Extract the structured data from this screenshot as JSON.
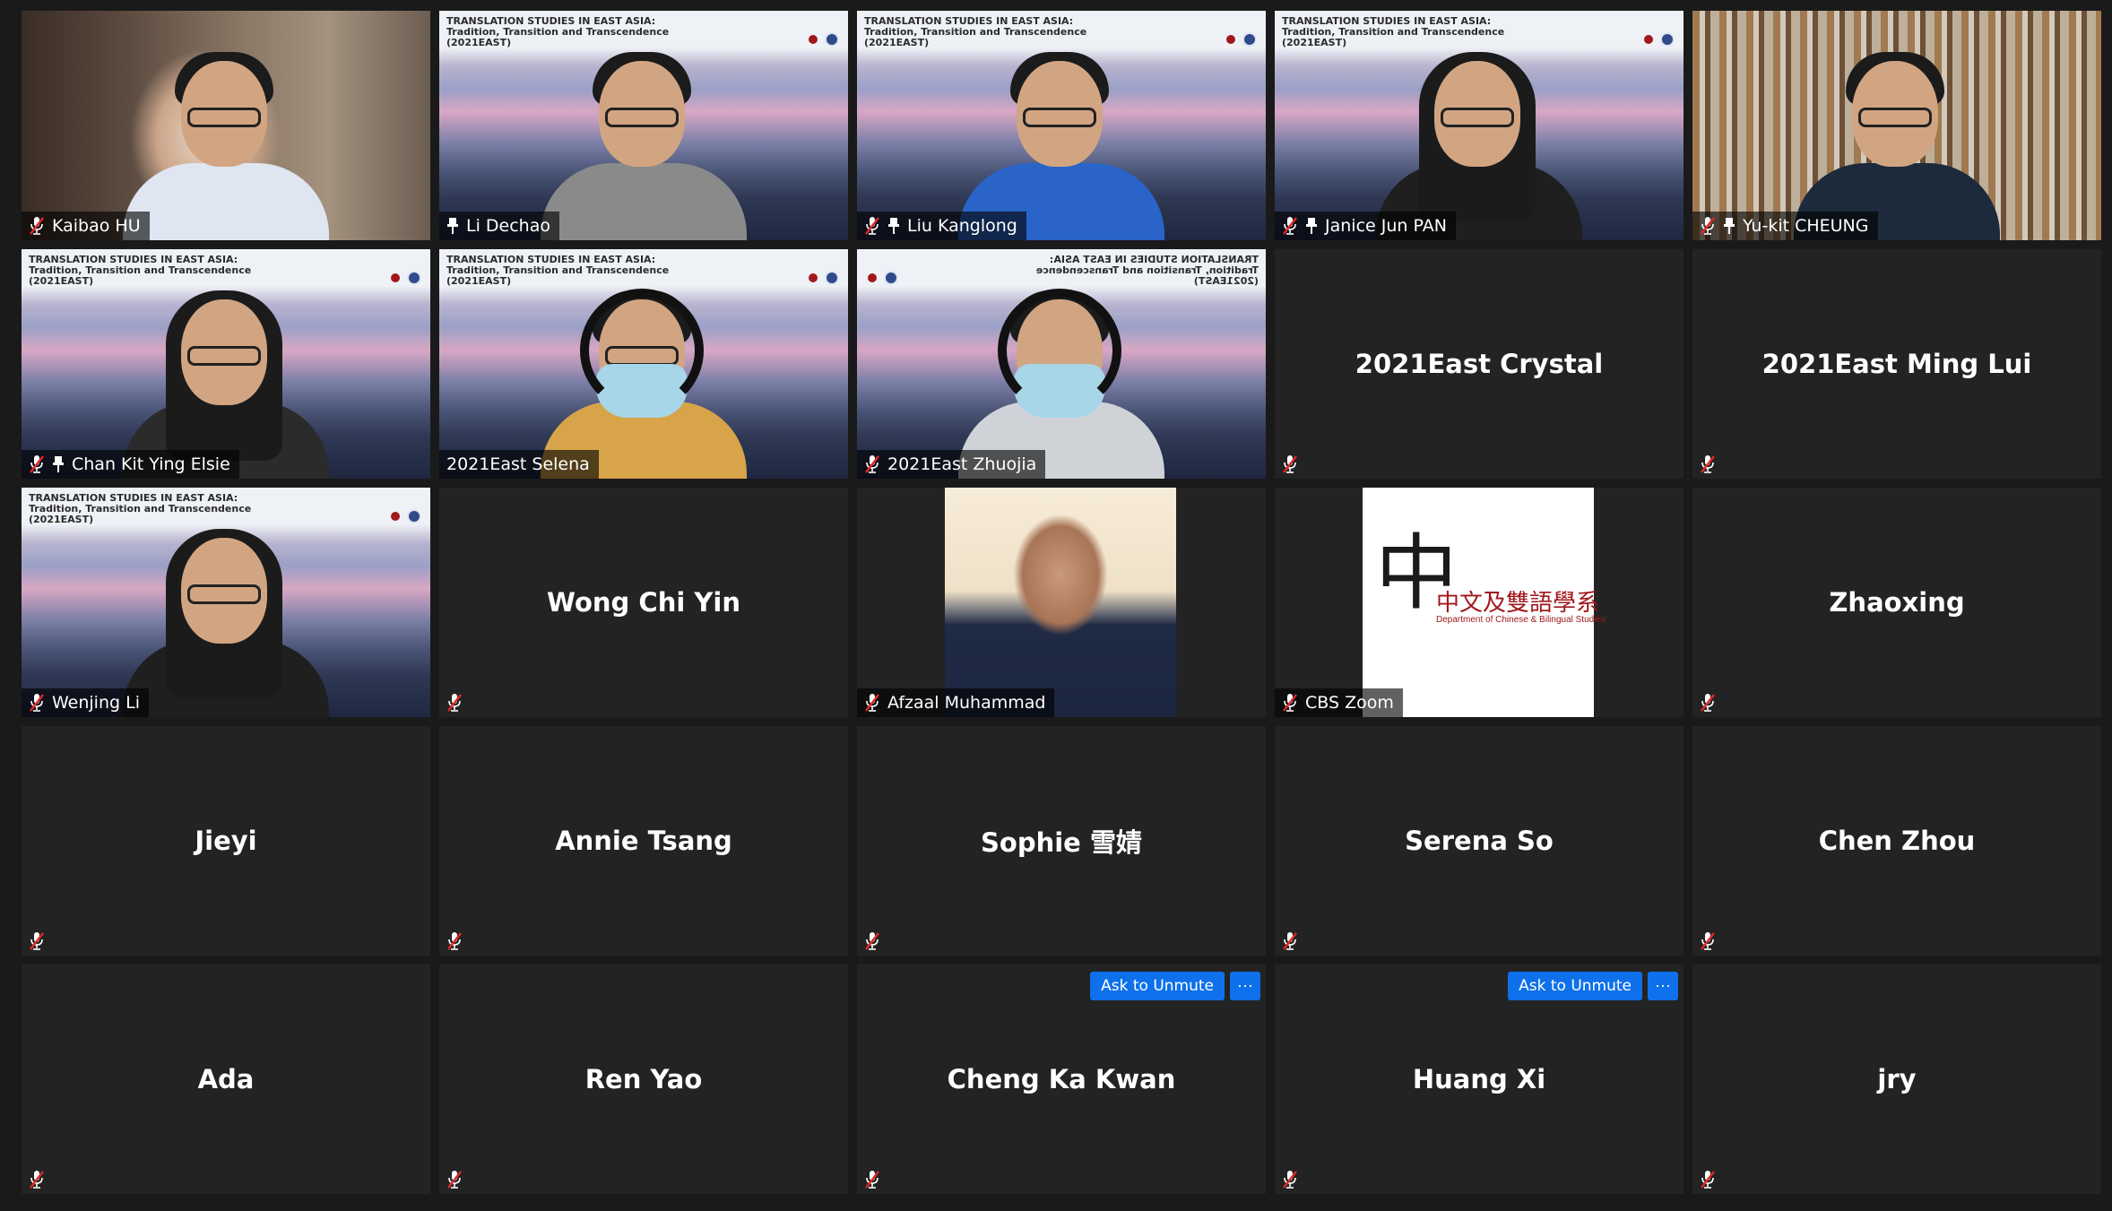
{
  "meeting": {
    "banner_title": "TRANSLATION STUDIES IN EAST ASIA:",
    "banner_subtitle": "Tradition, Transition and Transcendence",
    "banner_code": "(2021EAST)",
    "ask_unmute_label": "Ask to Unmute",
    "more_label": "···",
    "cbs_logo_text": "中文及雙語學系",
    "cbs_logo_sub": "Department of Chinese & Bilingual Studies",
    "active_speaker_color": "#d4e157",
    "button_color": "#0e71eb"
  },
  "participants": [
    {
      "name": "Kaibao HU",
      "video": "office",
      "muted": true,
      "pinned": false
    },
    {
      "name": "Li Dechao",
      "video": "city",
      "muted": false,
      "pinned": true
    },
    {
      "name": "Liu Kanglong",
      "video": "city",
      "muted": true,
      "pinned": true
    },
    {
      "name": "Janice Jun PAN",
      "video": "city",
      "muted": true,
      "pinned": true
    },
    {
      "name": "Yu-kit CHEUNG",
      "video": "books",
      "muted": true,
      "pinned": true
    },
    {
      "name": "Chan Kit Ying Elsie",
      "video": "city",
      "muted": true,
      "pinned": true
    },
    {
      "name": "2021East Selena",
      "video": "city",
      "muted": false,
      "pinned": false,
      "active": true
    },
    {
      "name": "2021East Zhuojia",
      "video": "city-flip",
      "muted": true,
      "pinned": false
    },
    {
      "name": "2021East Crystal",
      "video": "none",
      "muted": true
    },
    {
      "name": "2021East Ming Lui",
      "video": "none",
      "muted": true
    },
    {
      "name": "Wenjing Li",
      "video": "city",
      "muted": true,
      "pinned": false
    },
    {
      "name": "Wong Chi Yin",
      "video": "none",
      "muted": true
    },
    {
      "name": "Afzaal Muhammad",
      "video": "photo",
      "muted": true
    },
    {
      "name": "CBS Zoom",
      "video": "logo",
      "muted": true
    },
    {
      "name": "Zhaoxing",
      "video": "none",
      "muted": true
    },
    {
      "name": "Jieyi",
      "video": "none",
      "muted": true
    },
    {
      "name": "Annie Tsang",
      "video": "none",
      "muted": true
    },
    {
      "name": "Sophie 雪婧",
      "video": "none",
      "muted": true
    },
    {
      "name": "Serena So",
      "video": "none",
      "muted": true
    },
    {
      "name": "Chen Zhou",
      "video": "none",
      "muted": true
    },
    {
      "name": "Ada",
      "video": "none",
      "muted": true
    },
    {
      "name": "Ren Yao",
      "video": "none",
      "muted": true
    },
    {
      "name": "Cheng Ka Kwan",
      "video": "none",
      "muted": true,
      "hover": true
    },
    {
      "name": "Huang Xi",
      "video": "none",
      "muted": true,
      "hover": true
    },
    {
      "name": "jry",
      "video": "none",
      "muted": true
    }
  ]
}
